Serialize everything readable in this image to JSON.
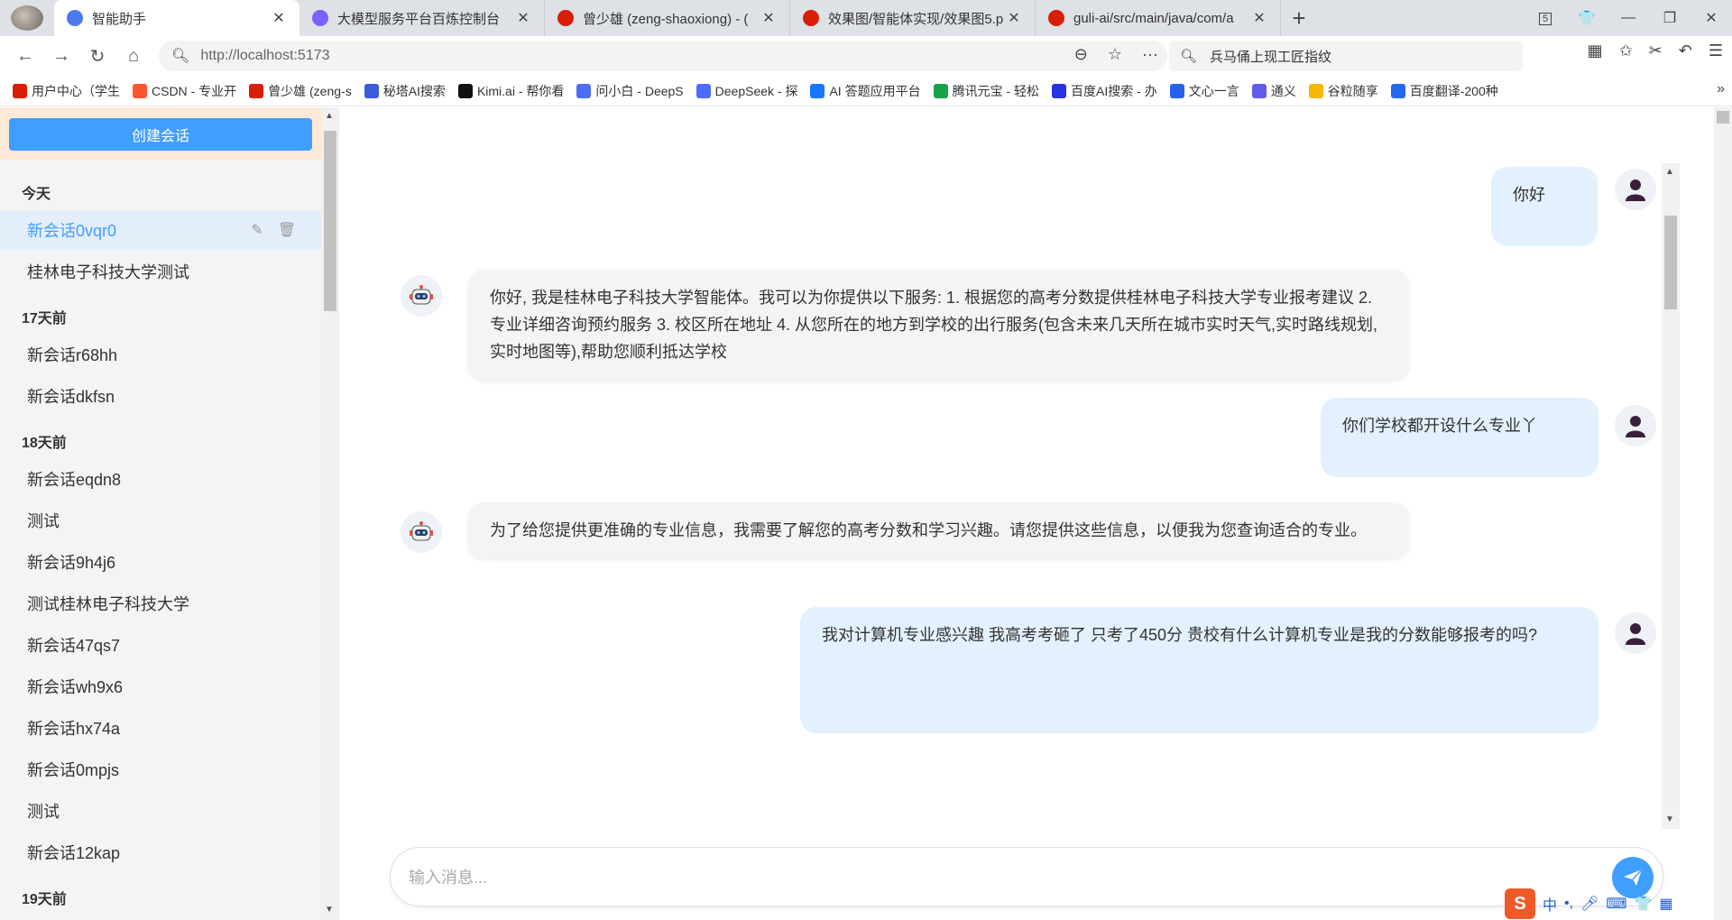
{
  "browser": {
    "tabs": [
      {
        "title": "智能助手",
        "icon_color": "#4b7bec",
        "active": true
      },
      {
        "title": "大模型服务平台百炼控制台",
        "icon_color": "#7b61ff",
        "active": false
      },
      {
        "title": "曾少雄 (zeng-shaoxiong) - (",
        "icon_color": "#d81e06",
        "active": false
      },
      {
        "title": "效果图/智能体实现/效果图5.p",
        "icon_color": "#d81e06",
        "active": false
      },
      {
        "title": "guli-ai/src/main/java/com/a",
        "icon_color": "#d81e06",
        "active": false
      }
    ],
    "tab_count": "5",
    "url": "http://localhost:5173",
    "search_text": "兵马俑上现工匠指纹",
    "bookmarks": [
      {
        "label": "用户中心（学生",
        "color": "#d81e06"
      },
      {
        "label": "CSDN - 专业开",
        "color": "#fc5531"
      },
      {
        "label": "曾少雄 (zeng-s",
        "color": "#d81e06"
      },
      {
        "label": "秘塔AI搜索",
        "color": "#3b5bdb"
      },
      {
        "label": "Kimi.ai - 帮你看",
        "color": "#111111"
      },
      {
        "label": "问小白 - DeepS",
        "color": "#4c6ef5"
      },
      {
        "label": "DeepSeek - 探",
        "color": "#4d6bfe"
      },
      {
        "label": "AI 答题应用平台",
        "color": "#1677ff"
      },
      {
        "label": "腾讯元宝 - 轻松",
        "color": "#16a34a"
      },
      {
        "label": "百度AI搜索 - 办",
        "color": "#2932e1"
      },
      {
        "label": "文心一言",
        "color": "#2563eb"
      },
      {
        "label": "通义",
        "color": "#615ced"
      },
      {
        "label": "谷粒随享",
        "color": "#f5b700"
      },
      {
        "label": "百度翻译-200种",
        "color": "#2468f2"
      }
    ]
  },
  "sidebar": {
    "create_label": "创建会话",
    "groups": [
      {
        "label": "今天",
        "items": [
          {
            "label": "新会话0vqr0",
            "active": true
          },
          {
            "label": "桂林电子科技大学测试",
            "active": false
          }
        ]
      },
      {
        "label": "17天前",
        "items": [
          {
            "label": "新会话r68hh",
            "active": false
          },
          {
            "label": "新会话dkfsn",
            "active": false
          }
        ]
      },
      {
        "label": "18天前",
        "items": [
          {
            "label": "新会话eqdn8",
            "active": false
          },
          {
            "label": "测试",
            "active": false
          },
          {
            "label": "新会话9h4j6",
            "active": false
          },
          {
            "label": "测试桂林电子科技大学",
            "active": false
          },
          {
            "label": "新会话47qs7",
            "active": false
          },
          {
            "label": "新会话wh9x6",
            "active": false
          },
          {
            "label": "新会话hx74a",
            "active": false
          },
          {
            "label": "新会话0mpjs",
            "active": false
          },
          {
            "label": "测试",
            "active": false
          },
          {
            "label": "新会话12kap",
            "active": false
          }
        ]
      },
      {
        "label": "19天前",
        "items": []
      }
    ]
  },
  "messages": [
    {
      "role": "user",
      "text": "你好"
    },
    {
      "role": "bot",
      "text": "你好, 我是桂林电子科技大学智能体。我可以为你提供以下服务: 1. 根据您的高考分数提供桂林电子科技大学专业报考建议 2. 专业详细咨询预约服务 3. 校区所在地址 4. 从您所在的地方到学校的出行服务(包含未来几天所在城市实时天气,实时路线规划,实时地图等),帮助您顺利抵达学校"
    },
    {
      "role": "user",
      "text": "你们学校都开设什么专业丫"
    },
    {
      "role": "bot",
      "text": "为了给您提供更准确的专业信息，我需要了解您的高考分数和学习兴趣。请您提供这些信息，以便我为您查询适合的专业。"
    },
    {
      "role": "user",
      "text": "我对计算机专业感兴趣 我高考考砸了 只考了450分 贵校有什么计算机专业是我的分数能够报考的吗?"
    }
  ],
  "input": {
    "placeholder": "输入消息..."
  },
  "ime": {
    "lang": "中"
  },
  "colors": {
    "primary": "#409eff",
    "user_bubble": "#e3f0fd",
    "bot_bubble": "#f4f4f4",
    "active_item": "#e4eefb"
  }
}
